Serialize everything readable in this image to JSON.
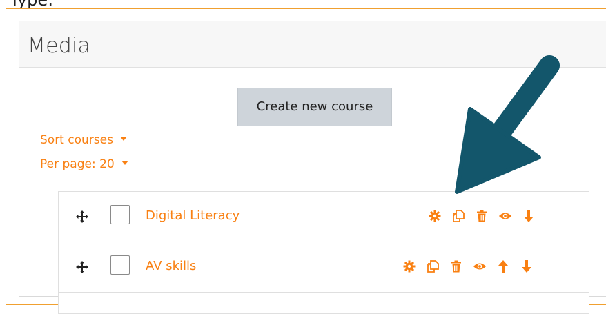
{
  "page": {
    "clipped_heading": "Type:"
  },
  "card": {
    "title": "Media"
  },
  "toolbar": {
    "create_label": "Create new course"
  },
  "controls": {
    "sort_label": "Sort courses",
    "per_page_label": "Per page: 20"
  },
  "courses": [
    {
      "name": "Digital Literacy",
      "actions": [
        "gear-icon",
        "copy-icon",
        "trash-icon",
        "eye-icon",
        "arrow-down-icon"
      ]
    },
    {
      "name": "AV skills",
      "actions": [
        "gear-icon",
        "copy-icon",
        "trash-icon",
        "eye-icon",
        "arrow-up-icon",
        "arrow-down-icon"
      ]
    }
  ],
  "colors": {
    "accent": "#f98012",
    "annotation_arrow": "#13566b",
    "button_bg": "#ced4da",
    "frame": "#f0a030"
  }
}
